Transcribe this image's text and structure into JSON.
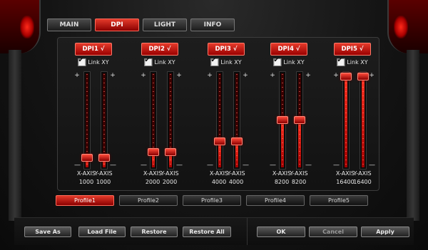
{
  "tabs": [
    {
      "label": "MAIN",
      "active": false
    },
    {
      "label": "DPI",
      "active": true
    },
    {
      "label": "LIGHT",
      "active": false
    },
    {
      "label": "INFO",
      "active": false
    }
  ],
  "dpi_levels": [
    {
      "label": "DPI1 √",
      "link_label": "Link XY",
      "linked": true,
      "x_label": "X-AXIS",
      "y_label": "Y-AXIS",
      "x_value": "1000",
      "y_value": "1000"
    },
    {
      "label": "DPI2 √",
      "link_label": "Link XY",
      "linked": true,
      "x_label": "X-AXIS",
      "y_label": "Y-AXIS",
      "x_value": "2000",
      "y_value": "2000"
    },
    {
      "label": "DPI3 √",
      "link_label": "Link XY",
      "linked": true,
      "x_label": "X-AXIS",
      "y_label": "Y-AXIS",
      "x_value": "4000",
      "y_value": "4000"
    },
    {
      "label": "DPI4 √",
      "link_label": "Link XY",
      "linked": true,
      "x_label": "X-AXIS",
      "y_label": "Y-AXIS",
      "x_value": "8200",
      "y_value": "8200"
    },
    {
      "label": "DPI5 √",
      "link_label": "Link XY",
      "linked": true,
      "x_label": "X-AXIS",
      "y_label": "Y-AXIS",
      "x_value": "16400",
      "y_value": "16400"
    }
  ],
  "slider_range": {
    "min": 0,
    "max": 16400,
    "plus": "+",
    "minus": "—"
  },
  "profiles": [
    {
      "label": "Profile1",
      "active": true
    },
    {
      "label": "Profile2",
      "active": false
    },
    {
      "label": "Profile3",
      "active": false
    },
    {
      "label": "Profile4",
      "active": false
    },
    {
      "label": "Profile5",
      "active": false
    }
  ],
  "footer": {
    "save_as": "Save As",
    "load_file": "Load File",
    "restore": "Restore",
    "restore_all": "Restore All",
    "ok": "OK",
    "cancel": "Cancel",
    "apply": "Apply"
  },
  "colors": {
    "accent": "#d42a1c",
    "background": "#141414"
  }
}
